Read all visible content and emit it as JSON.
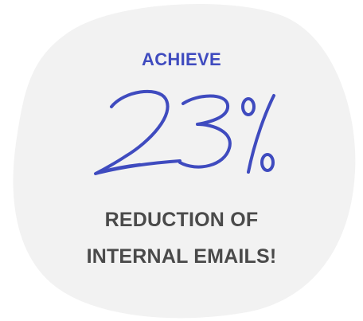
{
  "stat": {
    "headline": "ACHIEVE",
    "value": "23%",
    "line1": "REDUCTION OF",
    "line2": "INTERNAL EMAILS!"
  },
  "colors": {
    "accent": "#3f4bbf",
    "body_text": "#4a4a4a",
    "blob": "#f2f2f2"
  }
}
